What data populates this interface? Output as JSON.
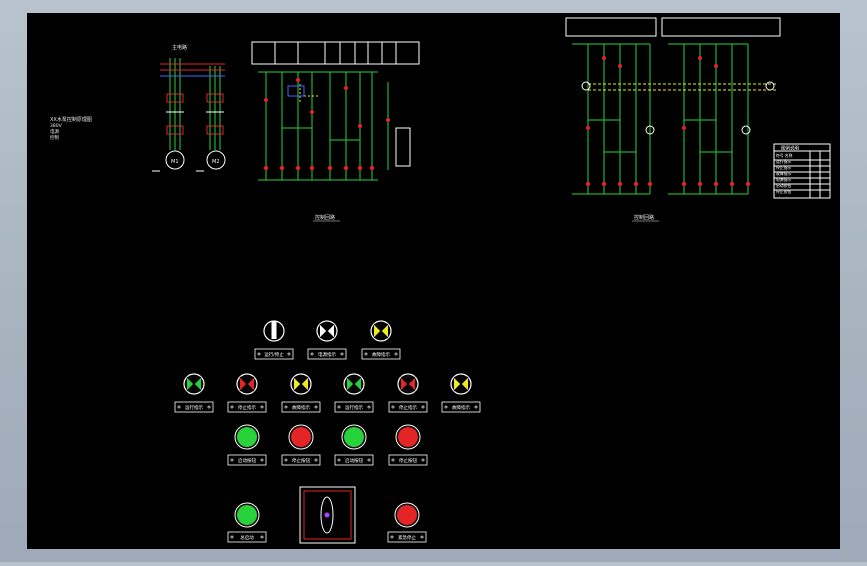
{
  "drawing": {
    "background": "#000000",
    "frame_color": "#ffffff",
    "wire_color": "#27d23a",
    "accent_red": "#e42525",
    "accent_yellow": "#f0ea22"
  },
  "main_circuit": {
    "title": "主电路",
    "note_lines": [
      "XX水泵控制原理图",
      "380V",
      "电源",
      "控制"
    ],
    "motor_labels": [
      "M1",
      "M2"
    ]
  },
  "control_circuit": {
    "caption": "控制回路"
  },
  "secondary_circuit": {
    "caption": "控制回路"
  },
  "panel": {
    "row1": [
      {
        "label": "运行/停止",
        "kind": "selector",
        "color": "#ffffff"
      },
      {
        "label": "电源指示",
        "kind": "lamp",
        "color": "#ffffff"
      },
      {
        "label": "故障指示",
        "kind": "lamp",
        "color": "#f0ea22"
      }
    ],
    "row2": [
      {
        "label": "运行指示",
        "kind": "lamp",
        "color": "#27d23a"
      },
      {
        "label": "停止指示",
        "kind": "lamp",
        "color": "#e42525"
      },
      {
        "label": "故障指示",
        "kind": "lamp",
        "color": "#f0ea22"
      },
      {
        "label": "运行指示",
        "kind": "lamp",
        "color": "#27d23a"
      },
      {
        "label": "停止指示",
        "kind": "lamp",
        "color": "#e42525"
      },
      {
        "label": "故障指示",
        "kind": "lamp",
        "color": "#f0ea22"
      }
    ],
    "row3": [
      {
        "label": "启动按钮",
        "kind": "button",
        "color": "#27d23a"
      },
      {
        "label": "停止按钮",
        "kind": "button",
        "color": "#e42525"
      },
      {
        "label": "启动按钮",
        "kind": "button",
        "color": "#27d23a"
      },
      {
        "label": "停止按钮",
        "kind": "button",
        "color": "#e42525"
      }
    ],
    "row4_left": {
      "label": "总启动",
      "color": "#27d23a"
    },
    "row4_right": {
      "label": "紧急停止",
      "color": "#e42525"
    }
  },
  "legend_table": {
    "title": "图例说明",
    "rows": [
      "符号  名称",
      "运行指示",
      "停止指示",
      "故障指示",
      "电源指示",
      "启动按钮",
      "停止按钮"
    ]
  }
}
